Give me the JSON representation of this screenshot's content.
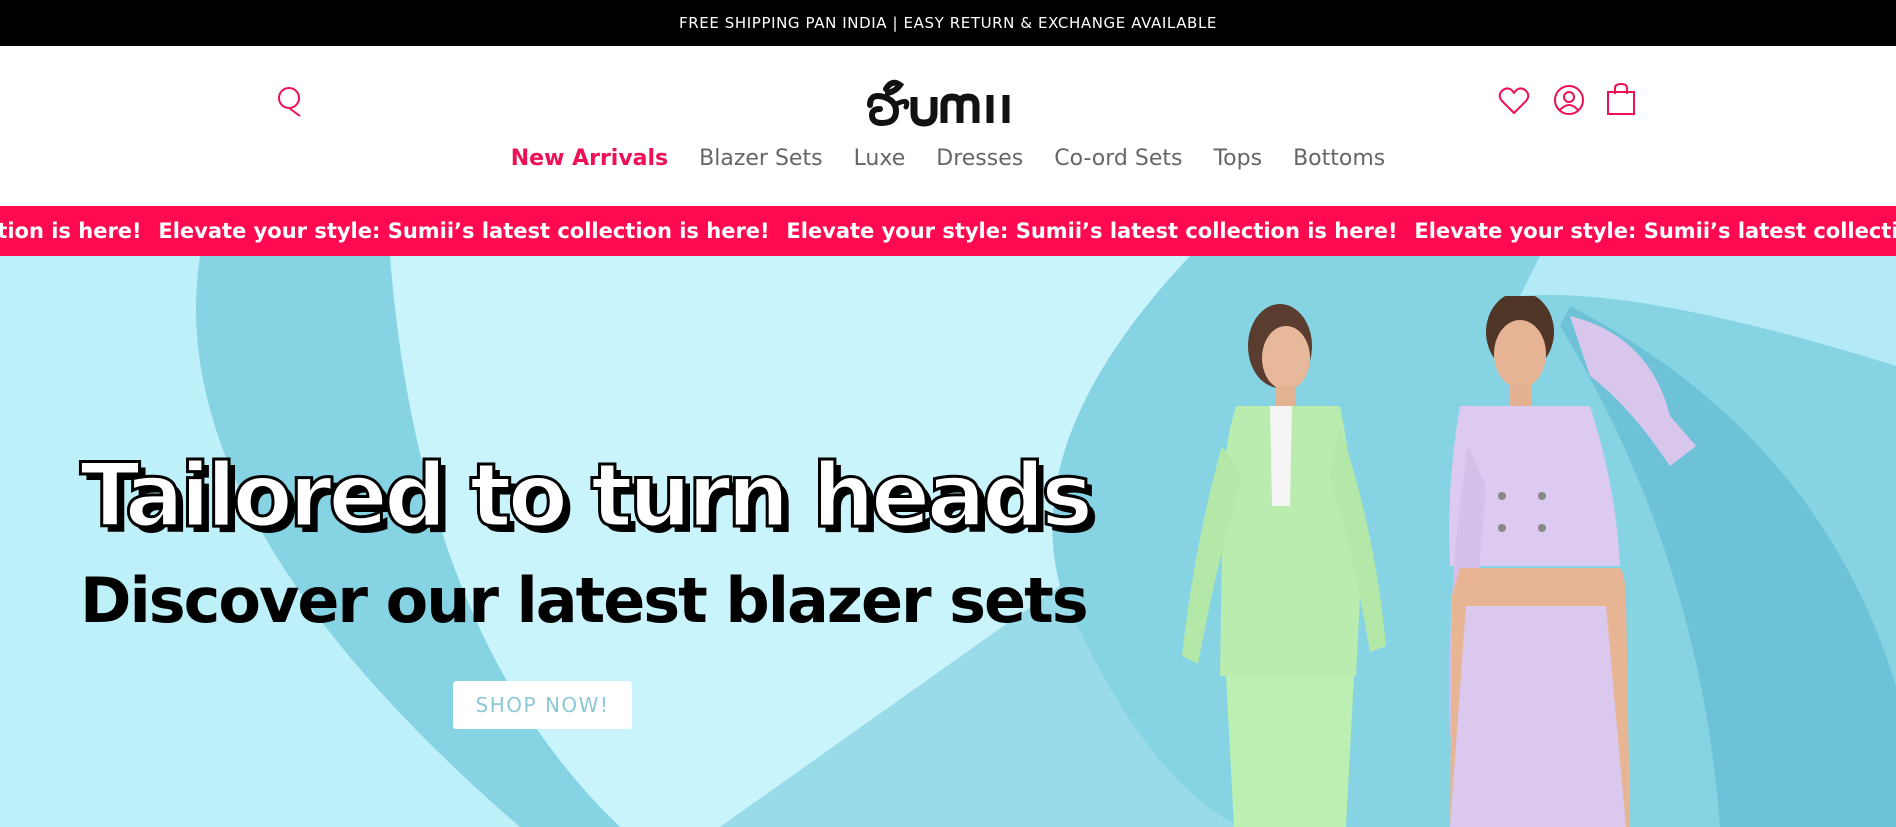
{
  "announcement": {
    "text": "FREE SHIPPING PAN INDIA | EASY RETURN & EXCHANGE AVAILABLE"
  },
  "header": {
    "logo_alt": "sumii",
    "icons": {
      "search": "search-icon",
      "wishlist": "heart-icon",
      "account": "user-icon",
      "cart": "shopping-bag-icon"
    },
    "accent_color": "#ee0f55"
  },
  "nav": {
    "items": [
      {
        "label": "New Arrivals",
        "active": true
      },
      {
        "label": "Blazer Sets",
        "active": false
      },
      {
        "label": "Luxe",
        "active": false
      },
      {
        "label": "Dresses",
        "active": false
      },
      {
        "label": "Co-ord Sets",
        "active": false
      },
      {
        "label": "Tops",
        "active": false
      },
      {
        "label": "Bottoms",
        "active": false
      }
    ]
  },
  "marquee": {
    "text": "Elevate your style: Sumii’s latest collection is here!",
    "background": "#ff0a50"
  },
  "hero": {
    "headline": "Tailored to turn heads",
    "subheadline": "Discover our latest blazer sets",
    "cta": "SHOP NOW!",
    "background": "#7ecfe2"
  }
}
